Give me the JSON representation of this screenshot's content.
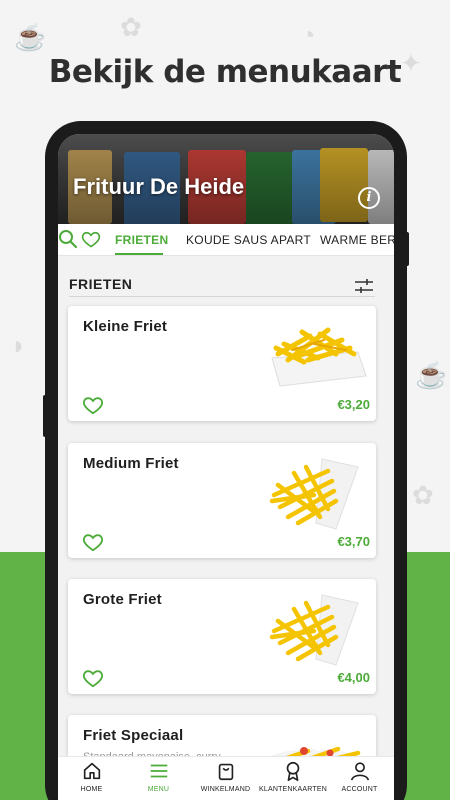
{
  "headline": "Bekijk de menukaart",
  "store": {
    "title": "Frituur De Heide",
    "info_icon": "info-icon"
  },
  "tabs": [
    {
      "label": "FRIETEN",
      "active": true
    },
    {
      "label": "KOUDE SAUS APART",
      "active": false
    },
    {
      "label": "WARME BERE",
      "active": false
    }
  ],
  "section": {
    "title": "FRIETEN"
  },
  "products": [
    {
      "name": "Kleine Friet",
      "price": "€3,20",
      "description": ""
    },
    {
      "name": "Medium Friet",
      "price": "€3,70",
      "description": ""
    },
    {
      "name": "Grote Friet",
      "price": "€4,00",
      "description": ""
    },
    {
      "name": "Friet Speciaal",
      "price": "",
      "description": "Standaard mayonaise, curry"
    }
  ],
  "nav": [
    {
      "label": "HOME",
      "icon": "home-icon",
      "active": false
    },
    {
      "label": "MENU",
      "icon": "menu-icon",
      "active": true
    },
    {
      "label": "WINKELMAND",
      "icon": "bag-icon",
      "active": false
    },
    {
      "label": "KLANTENKAARTEN",
      "icon": "badge-icon",
      "active": false
    },
    {
      "label": "ACCOUNT",
      "icon": "account-icon",
      "active": false
    }
  ],
  "colors": {
    "accent": "#4cab39",
    "bottom_band": "#61b348",
    "text": "#222222"
  }
}
